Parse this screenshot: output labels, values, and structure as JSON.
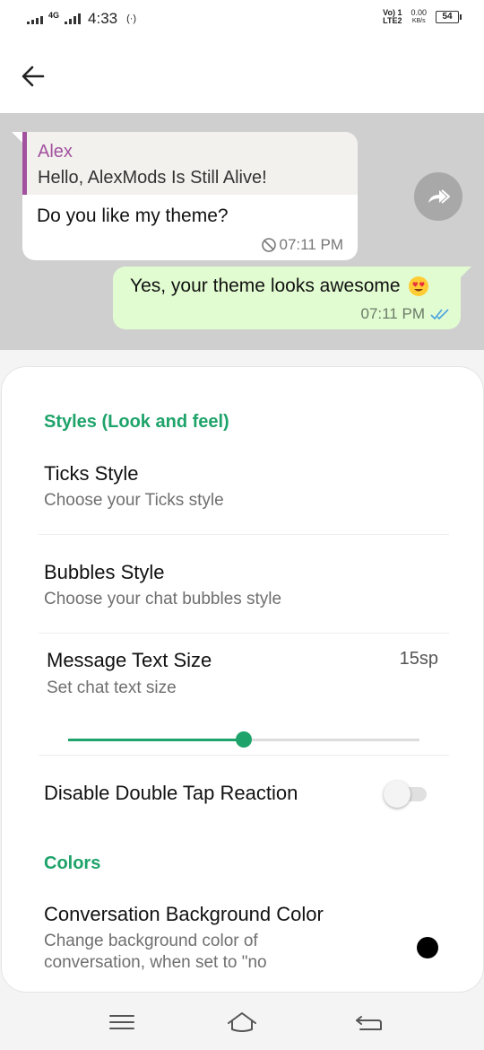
{
  "status_bar": {
    "network": "4G",
    "time": "4:33",
    "hotspot": "(·)",
    "volte_line1": "Vo) 1",
    "volte_line2": "LTE2",
    "speed_value": "0.00",
    "speed_unit": "KB/s",
    "battery": "54"
  },
  "chat_preview": {
    "incoming": {
      "quote_name": "Alex",
      "quote_text": "Hello, AlexMods Is Still Alive!",
      "text": "Do you like my theme?",
      "time": "07:11 PM"
    },
    "outgoing": {
      "text": "Yes, your theme looks awesome",
      "time": "07:11 PM"
    }
  },
  "settings": {
    "section_styles": "Styles (Look and feel)",
    "ticks_title": "Ticks Style",
    "ticks_subtitle": "Choose your Ticks style",
    "bubbles_title": "Bubbles Style",
    "bubbles_subtitle": "Choose your chat bubbles style",
    "text_size_title": "Message Text Size",
    "text_size_subtitle": "Set chat text size",
    "text_size_value": "15sp",
    "text_size_slider_fraction": 0.5,
    "double_tap_title": "Disable Double Tap Reaction",
    "double_tap_enabled": false,
    "section_colors": "Colors",
    "bg_color_title": "Conversation Background Color",
    "bg_color_subtitle_line1": "Change background color of",
    "bg_color_subtitle_line2": "conversation, when set to \"no",
    "bg_color_value": "#000000"
  },
  "colors": {
    "accent": "#1ea36a",
    "quote_name": "#a2519e",
    "outgoing_bubble": "#e2fcd1",
    "read_ticks": "#4aa3e0"
  },
  "icons": {
    "back": "arrow-left-icon",
    "forward": "share-forward-icon",
    "clock_blocked": "blocked-clock-icon",
    "read_ticks": "double-check-icon",
    "emoji": "heart-eyes-emoji-icon",
    "nav_menu": "menu-icon",
    "nav_home": "home-icon",
    "nav_back": "return-icon"
  }
}
